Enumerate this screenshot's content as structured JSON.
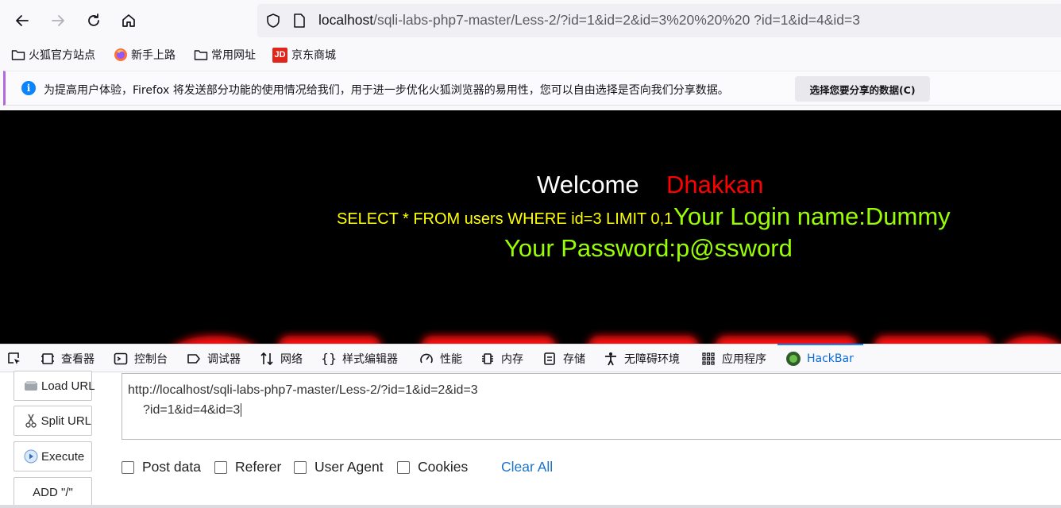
{
  "browser": {
    "url_host": "localhost",
    "url_path": "/sqli-labs-php7-master/Less-2/?id=1&id=2&id=3%20%20%20 ?id=1&id=4&id=3"
  },
  "bookmarks": [
    {
      "label": "火狐官方站点",
      "icon": "folder-icon"
    },
    {
      "label": "新手上路",
      "icon": "firefox-icon"
    },
    {
      "label": "常用网址",
      "icon": "folder-icon"
    },
    {
      "label": "京东商城",
      "icon": "jd-icon",
      "icon_text": "JD"
    }
  ],
  "notification": {
    "text": "为提高用户体验，Firefox 将发送部分功能的使用情况给我们，用于进一步优化火狐浏览器的易用性，您可以自由选择是否向我们分享数据。",
    "button": "选择您要分享的数据(C)"
  },
  "page": {
    "welcome": "Welcome",
    "welcome_name": "Dhakkan",
    "query": "SELECT * FROM users WHERE id=3 LIMIT 0,1",
    "login": "Your Login name:Dummy",
    "password": "Your Password:p@ssword"
  },
  "devtools": {
    "tabs": [
      "查看器",
      "控制台",
      "调试器",
      "网络",
      "样式编辑器",
      "性能",
      "内存",
      "存储",
      "无障碍环境",
      "应用程序",
      "HackBar"
    ],
    "active_tab": "HackBar"
  },
  "hackbar": {
    "buttons": [
      "Load URL",
      "Split URL",
      "Execute",
      "ADD \"/\""
    ],
    "url_line1": "http://localhost/sqli-labs-php7-master/Less-2/?id=1&id=2&id=3",
    "url_line2": "?id=1&id=4&id=3",
    "checkboxes": [
      "Post data",
      "Referer",
      "User Agent",
      "Cookies"
    ],
    "clear_all": "Clear All"
  },
  "colors": {
    "welcome": "#ffffff",
    "name": "#ff0000",
    "query": "#ffff00",
    "result": "#99ff00",
    "active_tab": "#0a84ff"
  }
}
